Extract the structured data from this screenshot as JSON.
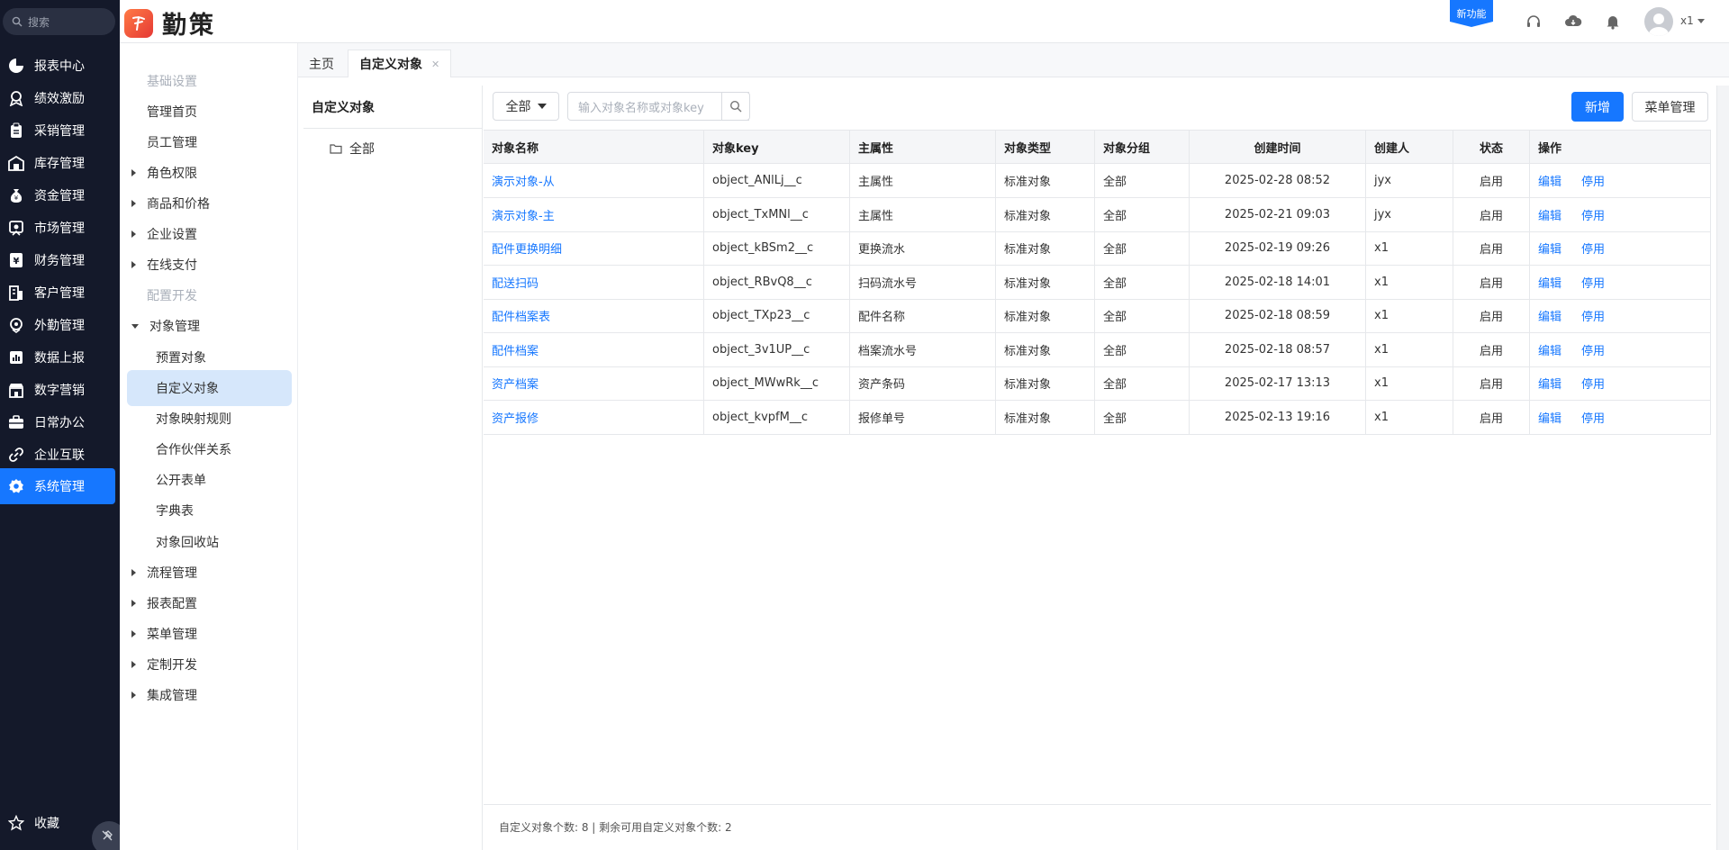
{
  "rail": {
    "search_placeholder": "搜索",
    "items": [
      {
        "label": "报表中心",
        "icon": "pie-chart-icon"
      },
      {
        "label": "绩效激励",
        "icon": "award-icon"
      },
      {
        "label": "采销管理",
        "icon": "clipboard-icon"
      },
      {
        "label": "库存管理",
        "icon": "warehouse-icon"
      },
      {
        "label": "资金管理",
        "icon": "money-bag-icon"
      },
      {
        "label": "市场管理",
        "icon": "market-icon"
      },
      {
        "label": "财务管理",
        "icon": "yen-icon"
      },
      {
        "label": "客户管理",
        "icon": "building-icon"
      },
      {
        "label": "外勤管理",
        "icon": "location-icon"
      },
      {
        "label": "数据上报",
        "icon": "report-icon"
      },
      {
        "label": "数字营销",
        "icon": "store-icon"
      },
      {
        "label": "日常办公",
        "icon": "briefcase-icon"
      },
      {
        "label": "企业互联",
        "icon": "link-icon"
      },
      {
        "label": "系统管理",
        "icon": "gear-icon"
      }
    ],
    "favorites_label": "收藏"
  },
  "header": {
    "brand": "勤策",
    "new_feature_badge": "新功能",
    "user_name": "x1"
  },
  "subnav": {
    "items": [
      {
        "label": "基础设置",
        "kind": "group"
      },
      {
        "label": "管理首页",
        "kind": "plain"
      },
      {
        "label": "员工管理",
        "kind": "plain"
      },
      {
        "label": "角色权限",
        "kind": "exp"
      },
      {
        "label": "商品和价格",
        "kind": "exp"
      },
      {
        "label": "企业设置",
        "kind": "exp"
      },
      {
        "label": "在线支付",
        "kind": "exp"
      },
      {
        "label": "配置开发",
        "kind": "group"
      },
      {
        "label": "对象管理",
        "kind": "exp-open"
      },
      {
        "label": "预置对象",
        "kind": "child"
      },
      {
        "label": "自定义对象",
        "kind": "active"
      },
      {
        "label": "对象映射规则",
        "kind": "child"
      },
      {
        "label": "合作伙伴关系",
        "kind": "child"
      },
      {
        "label": "公开表单",
        "kind": "child"
      },
      {
        "label": "字典表",
        "kind": "child"
      },
      {
        "label": "对象回收站",
        "kind": "child"
      },
      {
        "label": "流程管理",
        "kind": "exp"
      },
      {
        "label": "报表配置",
        "kind": "exp"
      },
      {
        "label": "菜单管理",
        "kind": "exp"
      },
      {
        "label": "定制开发",
        "kind": "exp"
      },
      {
        "label": "集成管理",
        "kind": "exp"
      }
    ]
  },
  "tabs": {
    "home": "主页",
    "current": "自定义对象"
  },
  "tree": {
    "title": "自定义对象",
    "root": "全部"
  },
  "toolbar": {
    "filter_value": "全部",
    "search_placeholder": "输入对象名称或对象key",
    "add_label": "新增",
    "menu_label": "菜单管理"
  },
  "table": {
    "columns": [
      "对象名称",
      "对象key",
      "主属性",
      "对象类型",
      "对象分组",
      "创建时间",
      "创建人",
      "状态",
      "操作"
    ],
    "rows": [
      {
        "name": "演示对象-从",
        "key": "object_ANlLj__c",
        "main": "主属性",
        "type": "标准对象",
        "group": "全部",
        "created": "2025-02-28 08:52",
        "creator": "jyx",
        "status": "启用"
      },
      {
        "name": "演示对象-主",
        "key": "object_TxMNl__c",
        "main": "主属性",
        "type": "标准对象",
        "group": "全部",
        "created": "2025-02-21 09:03",
        "creator": "jyx",
        "status": "启用"
      },
      {
        "name": "配件更换明细",
        "key": "object_kBSm2__c",
        "main": "更换流水",
        "type": "标准对象",
        "group": "全部",
        "created": "2025-02-19 09:26",
        "creator": "x1",
        "status": "启用"
      },
      {
        "name": "配送扫码",
        "key": "object_RBvQ8__c",
        "main": "扫码流水号",
        "type": "标准对象",
        "group": "全部",
        "created": "2025-02-18 14:01",
        "creator": "x1",
        "status": "启用"
      },
      {
        "name": "配件档案表",
        "key": "object_TXp23__c",
        "main": "配件名称",
        "type": "标准对象",
        "group": "全部",
        "created": "2025-02-18 08:59",
        "creator": "x1",
        "status": "启用"
      },
      {
        "name": "配件档案",
        "key": "object_3v1UP__c",
        "main": "档案流水号",
        "type": "标准对象",
        "group": "全部",
        "created": "2025-02-18 08:57",
        "creator": "x1",
        "status": "启用"
      },
      {
        "name": "资产档案",
        "key": "object_MWwRk__c",
        "main": "资产条码",
        "type": "标准对象",
        "group": "全部",
        "created": "2025-02-17 13:13",
        "creator": "x1",
        "status": "启用"
      },
      {
        "name": "资产报修",
        "key": "object_kvpfM__c",
        "main": "报修单号",
        "type": "标准对象",
        "group": "全部",
        "created": "2025-02-13 19:16",
        "creator": "x1",
        "status": "启用"
      }
    ],
    "edit_label": "编辑",
    "disable_label": "停用"
  },
  "footer": {
    "summary": "自定义对象个数: 8 | 剩余可用自定义对象个数: 2"
  },
  "colors": {
    "accent": "#1677ff",
    "rail_bg": "#14192a",
    "active_sub_bg": "#d6e7fb"
  }
}
